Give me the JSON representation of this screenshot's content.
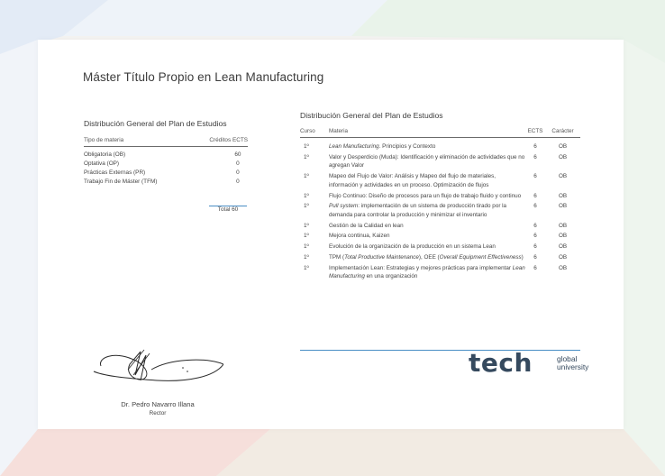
{
  "colors": {
    "accent": "#4a8ec5",
    "logo_dark": "#35495e",
    "logo_teal": "#2ec4c4"
  },
  "title": "Máster Título Propio en Lean Manufacturing",
  "summary": {
    "title": "Distribución General del Plan de Estudios",
    "col_type": "Tipo de materia",
    "col_credits": "Créditos ECTS",
    "rows": [
      {
        "type": "Obligatoria (OB)",
        "credits": "60"
      },
      {
        "type": "Optativa (OP)",
        "credits": "0"
      },
      {
        "type": "Prácticas Externas (PR)",
        "credits": "0"
      },
      {
        "type": "Trabajo Fin de Máster (TFM)",
        "credits": "0"
      }
    ],
    "total": "Total 60"
  },
  "plan": {
    "title": "Distribución General del Plan de Estudios",
    "headers": {
      "curso": "Curso",
      "materia": "Materia",
      "ects": "ECTS",
      "caracter": "Carácter"
    },
    "rows": [
      {
        "curso": "1º",
        "m1": "Lean Manufacturing",
        "m2": ". Principios y Contexto",
        "ects": "6",
        "car": "OB"
      },
      {
        "curso": "1º",
        "materia": "Valor y Desperdicio (Muda): Identificación y eliminación de actividades que no agregan Valor",
        "ects": "6",
        "car": "OB"
      },
      {
        "curso": "1º",
        "materia": "Mapeo del Flujo de Valor: Análisis y Mapeo del flujo de materiales, información y actividades en un proceso. Optimización de flujos",
        "ects": "6",
        "car": "OB"
      },
      {
        "curso": "1º",
        "materia": "Flujo Continuo: Diseño de procesos para un flujo de trabajo fluido y continuo",
        "ects": "6",
        "car": "OB"
      },
      {
        "curso": "1º",
        "m1": "Pull system",
        "m2": ": implementación de un sistema de producción tirado por la demanda para controlar la producción y minimizar el inventario",
        "ects": "6",
        "car": "OB"
      },
      {
        "curso": "1º",
        "materia": "Gestión de la Calidad en lean",
        "ects": "6",
        "car": "OB"
      },
      {
        "curso": "1º",
        "materia": "Mejora continua, Kaizen",
        "ects": "6",
        "car": "OB"
      },
      {
        "curso": "1º",
        "materia": "Evolución de la organización de la producción en un sistema Lean",
        "ects": "6",
        "car": "OB"
      },
      {
        "curso": "1º",
        "m1": "TPM (",
        "m2": "Total Productive Maintenance",
        "m3": "), OEE (",
        "m4": "Overall Equipment Effectiveness",
        "m5": ")",
        "ects": "6",
        "car": "OB"
      },
      {
        "curso": "1º",
        "m1": "Implementación Lean: Estrategias y mejores prácticas para implementar ",
        "m2": "Lean Manufacturing",
        "m3": " en una organización",
        "ects": "6",
        "car": "OB"
      }
    ]
  },
  "signature": {
    "name": "Dr. Pedro Navarro Illana",
    "role": "Rector"
  },
  "logo": {
    "brand": "tech",
    "line1": "global",
    "line2": "university"
  }
}
